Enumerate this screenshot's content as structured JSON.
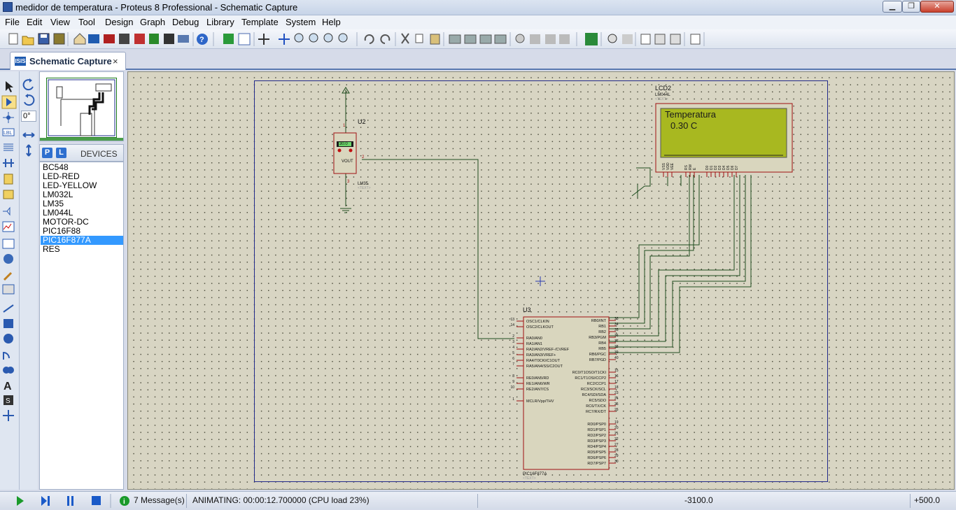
{
  "window": {
    "title": "medidor de temperatura - Proteus 8 Professional - Schematic Capture",
    "min_label": "▁",
    "max_label": "❐",
    "close_label": "✕"
  },
  "menu": [
    "File",
    "Edit",
    "View",
    "Tool",
    "Design",
    "Graph",
    "Debug",
    "Library",
    "Template",
    "System",
    "Help"
  ],
  "tab": {
    "icon": "ISIS",
    "label": "Schematic Capture",
    "close": "×"
  },
  "rotation": "0°",
  "devices": {
    "p_label": "P",
    "l_label": "L",
    "header": "DEVICES",
    "items": [
      "BC548",
      "LED-RED",
      "LED-YELLOW",
      "LM032L",
      "LM35",
      "LM044L",
      "MOTOR-DC",
      "PIC16F88",
      "PIC16F877A",
      "RES"
    ],
    "selected": "PIC16F877A"
  },
  "schematic": {
    "u2": {
      "ref": "U2",
      "display": "30.0",
      "vout": "VOUT",
      "part": "LM35",
      "text": "<TEXT>",
      "pin1": "1",
      "pin2": "2",
      "pin3": "3"
    },
    "lcd": {
      "ref": "LCD2",
      "part": "LM044L",
      "text": "<TEXT>",
      "line1": "Temperatura",
      "line2": "0.30 C",
      "pins": [
        "VSS",
        "VDD",
        "VEE",
        "RS",
        "RW",
        "E",
        "D0",
        "D1",
        "D2",
        "D3",
        "D4",
        "D5",
        "D6",
        "D7"
      ]
    },
    "u3": {
      "ref": "U3",
      "part": "PIC16F877A",
      "text": "<TEXT>",
      "left_pins": [
        {
          "num": "13",
          "name": "OSC1/CLKIN"
        },
        {
          "num": "14",
          "name": "OSC2/CLKOUT"
        },
        {
          "num": "2",
          "name": "RA0/AN0"
        },
        {
          "num": "3",
          "name": "RA1/AN1"
        },
        {
          "num": "4",
          "name": "RA2/AN2/VREF-/CVREF"
        },
        {
          "num": "5",
          "name": "RA3/AN3/VREF+"
        },
        {
          "num": "6",
          "name": "RA4/T0CKI/C1OUT"
        },
        {
          "num": "7",
          "name": "RA5/AN4/SS/C2OUT"
        },
        {
          "num": "8",
          "name": "RE0/AN5/RD"
        },
        {
          "num": "9",
          "name": "RE1/AN6/WR"
        },
        {
          "num": "10",
          "name": "RE2/AN7/CS"
        },
        {
          "num": "1",
          "name": "MCLR/Vpp/THV"
        }
      ],
      "right_pins": [
        {
          "num": "33",
          "name": "RB0/INT"
        },
        {
          "num": "34",
          "name": "RB1"
        },
        {
          "num": "35",
          "name": "RB2"
        },
        {
          "num": "36",
          "name": "RB3/PGM"
        },
        {
          "num": "37",
          "name": "RB4"
        },
        {
          "num": "38",
          "name": "RB5"
        },
        {
          "num": "39",
          "name": "RB6/PGC"
        },
        {
          "num": "40",
          "name": "RB7/PGD"
        },
        {
          "num": "15",
          "name": "RC0/T1OSO/T1CKI"
        },
        {
          "num": "16",
          "name": "RC1/T1OSI/CCP2"
        },
        {
          "num": "17",
          "name": "RC2/CCP1"
        },
        {
          "num": "18",
          "name": "RC3/SCK/SCL"
        },
        {
          "num": "23",
          "name": "RC4/SDI/SDA"
        },
        {
          "num": "24",
          "name": "RC5/SDO"
        },
        {
          "num": "25",
          "name": "RC6/TX/CK"
        },
        {
          "num": "26",
          "name": "RC7/RX/DT"
        },
        {
          "num": "19",
          "name": "RD0/PSP0"
        },
        {
          "num": "20",
          "name": "RD1/PSP1"
        },
        {
          "num": "21",
          "name": "RD2/PSP2"
        },
        {
          "num": "22",
          "name": "RD3/PSP3"
        },
        {
          "num": "27",
          "name": "RD4/PSP4"
        },
        {
          "num": "28",
          "name": "RD5/PSP5"
        },
        {
          "num": "29",
          "name": "RD6/PSP6"
        },
        {
          "num": "30",
          "name": "RD7/PSP7"
        }
      ]
    }
  },
  "status": {
    "messages": "7 Message(s)",
    "animating": "ANIMATING: 00:00:12.700000 (CPU load 23%)",
    "coord_x": "-3100.0",
    "coord_y": "+500.0"
  },
  "colors": {
    "wire": "#1f4d1f",
    "component_border": "#a01010",
    "component_fill": "#d9d6be",
    "lcd_screen": "#a8b820",
    "sheet_border": "#222a8a"
  }
}
